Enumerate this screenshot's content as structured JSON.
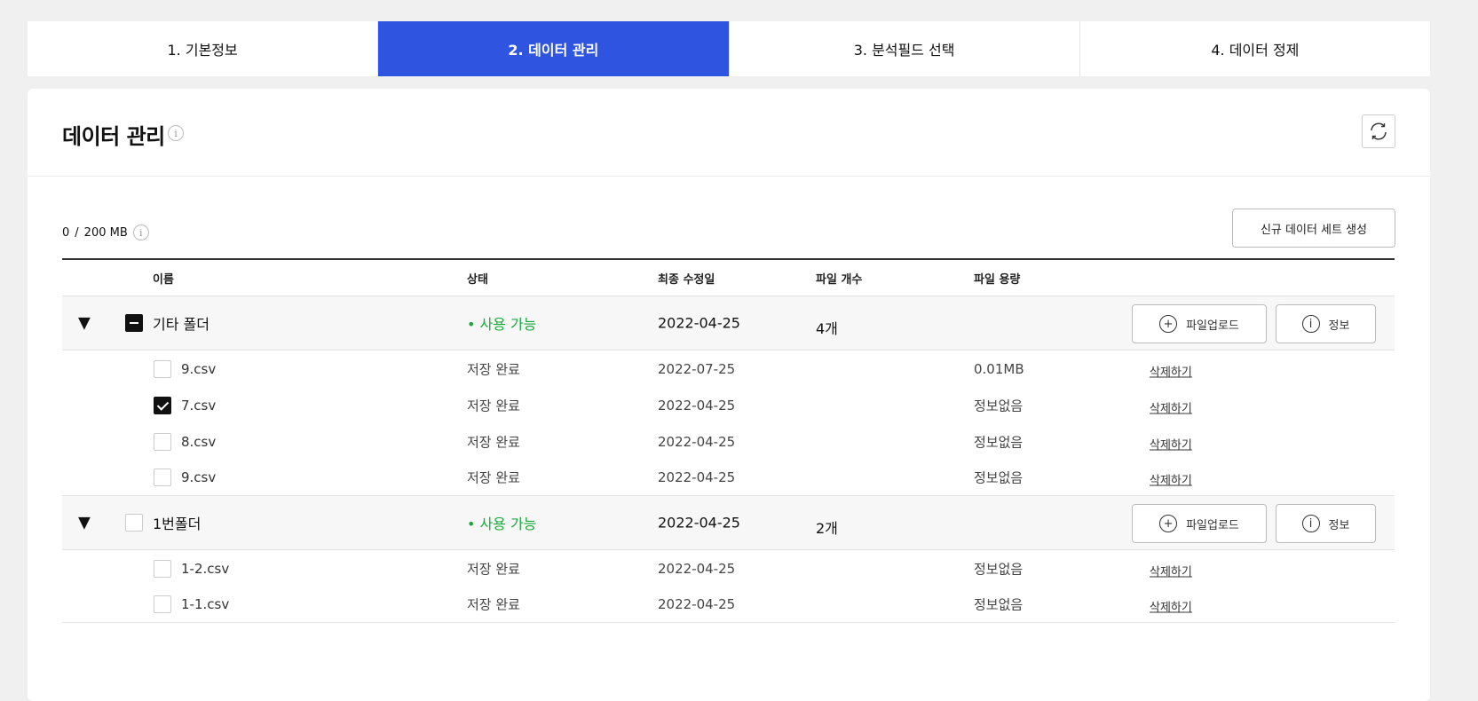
{
  "steps": [
    "1. 기본정보",
    "2. 데이터 관리",
    "3. 분석필드 선택",
    "4. 데이터 정제"
  ],
  "active_step": 1,
  "panel": {
    "title": "데이터 관리",
    "info_icon": "i"
  },
  "quota": {
    "used": "0",
    "separator": "/",
    "total": "200 MB",
    "info_icon": "i"
  },
  "new_button": "신규 데이터 세트 생성",
  "table": {
    "headers": {
      "name": "이름",
      "status": "상태",
      "date": "최종 수정일",
      "count": "파일 개수",
      "size": "파일 용량"
    },
    "upload_label": "파일업로드",
    "info_label": "정보",
    "delete_label": "삭제하기",
    "folders": [
      {
        "name": "기타 폴더",
        "status": "사용 가능",
        "date": "2022-04-25",
        "count": "4개",
        "checkbox": "indeterminate",
        "files": [
          {
            "name": "9.csv",
            "status": "저장 완료",
            "date": "2022-07-25",
            "size": "0.01MB",
            "checked": false
          },
          {
            "name": "7.csv",
            "status": "저장 완료",
            "date": "2022-04-25",
            "size": "정보없음",
            "checked": true
          },
          {
            "name": "8.csv",
            "status": "저장 완료",
            "date": "2022-04-25",
            "size": "정보없음",
            "checked": false
          },
          {
            "name": "9.csv",
            "status": "저장 완료",
            "date": "2022-04-25",
            "size": "정보없음",
            "checked": false
          }
        ]
      },
      {
        "name": "1번폴더",
        "status": "사용 가능",
        "date": "2022-04-25",
        "count": "2개",
        "checkbox": "unchecked",
        "files": [
          {
            "name": "1-2.csv",
            "status": "저장 완료",
            "date": "2022-04-25",
            "size": "정보없음",
            "checked": false
          },
          {
            "name": "1-1.csv",
            "status": "저장 완료",
            "date": "2022-04-25",
            "size": "정보없음",
            "checked": false
          }
        ]
      }
    ]
  },
  "colors": {
    "accent": "#2f55e0",
    "status_available": "#1ba83a"
  },
  "icons": {
    "toggle": "▼",
    "plus": "+",
    "info": "i"
  }
}
